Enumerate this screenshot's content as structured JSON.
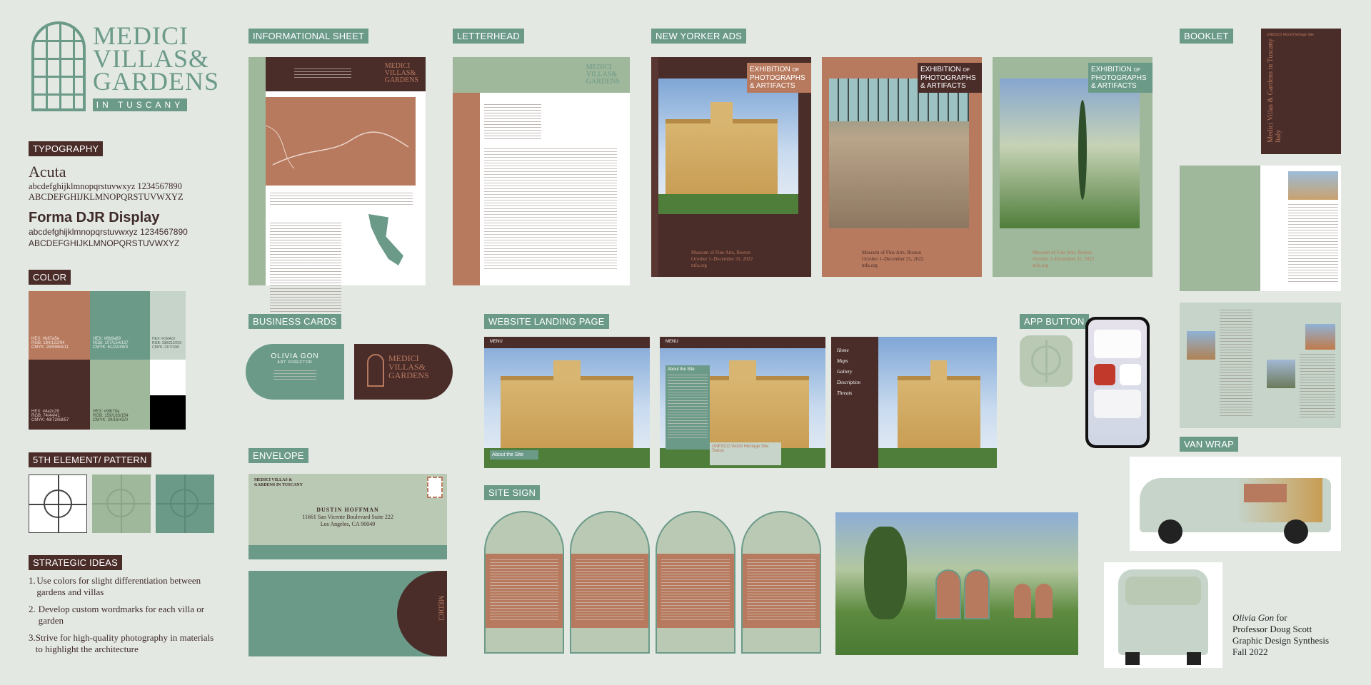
{
  "brand": {
    "line1": "MEDICI",
    "line2": "VILLAS&",
    "line3": "GARDENS",
    "line4": "IN TUSCANY"
  },
  "labels": {
    "typography": "TYPOGRAPHY",
    "color": "COLOR",
    "pattern": "5TH ELEMENT/ PATTERN",
    "strategic": "STRATEGIC IDEAS",
    "info_sheet": "INFORMATIONAL SHEET",
    "letterhead": "LETTERHEAD",
    "ads": "NEW YORKER ADS",
    "booklet": "BOOKLET",
    "business_cards": "BUSINESS CARDS",
    "website": "WEBSITE LANDING PAGE",
    "app_button": "APP BUTTON",
    "envelope": "ENVELOPE",
    "site_sign": "SITE SIGN",
    "van_wrap": "VAN WRAP"
  },
  "typography": {
    "font1": "Acuta",
    "font1_lower": "abcdefghijklmnopqrstuvwxyz 1234567890",
    "font1_upper": "ABCDEFGHIJKLMNOPQRSTUVWXYZ",
    "font2": "Forma DJR Display",
    "font2_lower": "abcdefghijklmnopqrstuvwxyz 1234567890",
    "font2_upper": "ABCDEFGHIJKLMNOPQRSTUVWXYZ"
  },
  "colors": [
    {
      "hex": "#b87a5e",
      "l1": "HEX: #b87a5e",
      "l2": "RGB: 184/122/94",
      "l3": "CMYK: 25/59/64/11"
    },
    {
      "hex": "#6b9a89",
      "l1": "HEX: #6b9a89",
      "l2": "RGB: 107/154/137",
      "l3": "CMYK: 61/22/49/3"
    },
    {
      "hex": "#c6d4c9",
      "l1": "HEX: #c6d4c9",
      "l2": "RGB: 198/212/201",
      "l3": "CMYK: 21/7/19/0"
    },
    {
      "hex": "#4a2c29",
      "l1": "HEX: #4a2c29",
      "l2": "RGB: 74/44/41",
      "l3": "CMYK: 48/72/68/57"
    },
    {
      "hex": "#9fb79a",
      "l1": "HEX: #9fb79a",
      "l2": "RGB: 159/183/154",
      "l3": "CMYK: 39/16/42/0"
    },
    {
      "hex": "#ffffff"
    },
    {
      "hex": "#000000"
    }
  ],
  "strategic_ideas": [
    {
      "num": "1.",
      "text": "Use colors for slight differentiation between gardens and villas"
    },
    {
      "num": "2.",
      "text": "Develop custom wordmarks for each villa or garden"
    },
    {
      "num": "3.",
      "text": "Strive for high-quality photography in materials to highlight the architecture"
    }
  ],
  "ad": {
    "title1": "EXHIBITION",
    "title_of": "OF",
    "title2": "PHOTOGRAPHS",
    "title3": "& ARTIFACTS",
    "venue": "Museum of Fine Arts, Boston",
    "dates": "October 1–December 31, 2022",
    "url": "mfa.org"
  },
  "booklet": {
    "cover_top": "UNESCO World Heritage Site",
    "cover_title": "Medici Villas & Gardens in Tuscany",
    "cover_sub": "Italy"
  },
  "card": {
    "name": "OLIVIA GON",
    "role": "ART DIRECTOR"
  },
  "website": {
    "menu": "MENU",
    "about": "About the Site",
    "unesco": "UNESCO World Heritage Site Status",
    "nav": [
      "Home",
      "Maps",
      "Gallery",
      "Description",
      "Threats"
    ]
  },
  "envelope": {
    "return1": "MEDICI VILLAS &",
    "return2": "GARDENS IN TUSCANY",
    "to_name": "DUSTIN HOFFMAN",
    "to_addr": "11661 San Vicente Boulevard Suite 222",
    "to_city": "Los Angeles, CA 90049"
  },
  "credit": {
    "name": "Olivia Gon",
    "for": " for",
    "line2": "Professor Doug Scott",
    "line3": "Graphic Design Synthesis",
    "line4": "Fall 2022"
  },
  "palette": {
    "terra": "#b87a5e",
    "sage": "#6b9a89",
    "mint": "#c6d4c9",
    "brown": "#4a2c29",
    "olive": "#9fb79a",
    "bg": "#e3e8e3"
  }
}
